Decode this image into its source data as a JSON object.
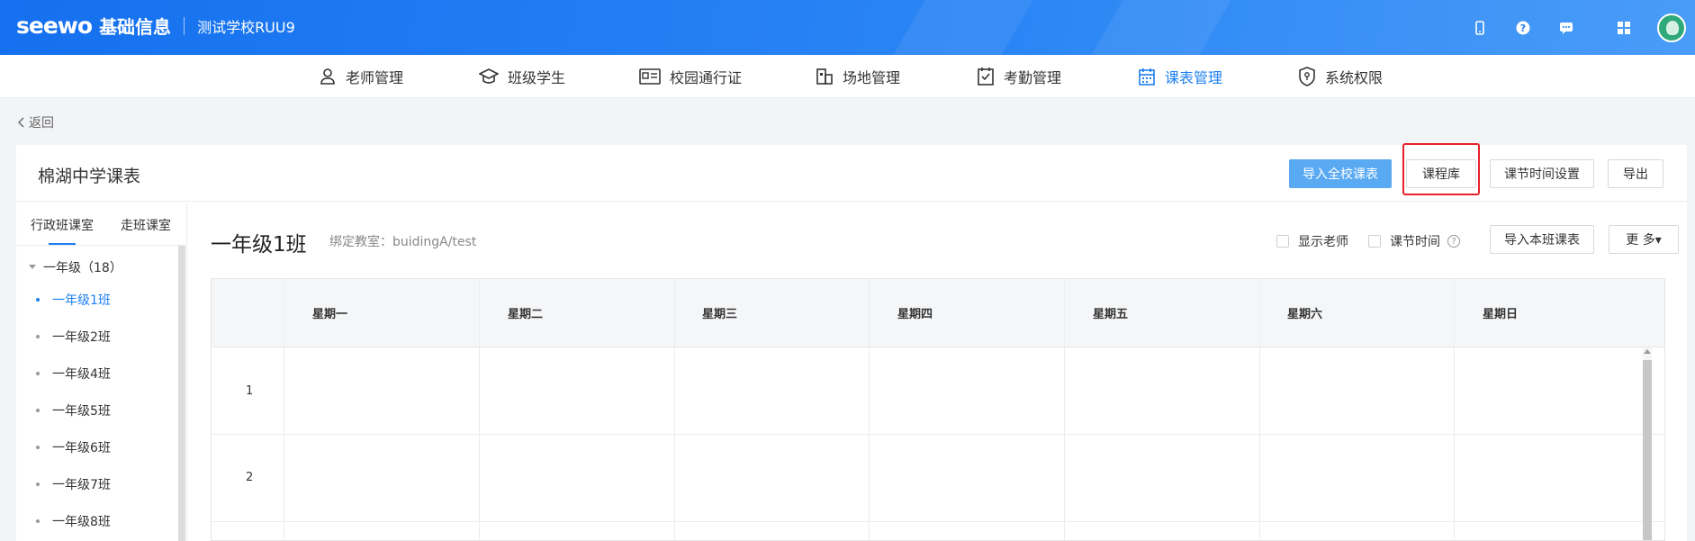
{
  "header": {
    "logo": "seewo",
    "product": "基础信息",
    "school": "测试学校RUU9"
  },
  "nav": {
    "items": [
      {
        "label": "老师管理",
        "icon": "person-icon"
      },
      {
        "label": "班级学生",
        "icon": "graduation-cap-icon"
      },
      {
        "label": "校园通行证",
        "icon": "id-card-icon"
      },
      {
        "label": "场地管理",
        "icon": "building-icon"
      },
      {
        "label": "考勤管理",
        "icon": "clipboard-check-icon"
      },
      {
        "label": "课表管理",
        "icon": "calendar-icon",
        "active": true
      },
      {
        "label": "系统权限",
        "icon": "shield-icon"
      }
    ]
  },
  "back_label": "返回",
  "panel": {
    "title": "棉湖中学课表",
    "buttons": {
      "import_all": "导入全校课表",
      "course_library": "课程库",
      "period_time": "课节时间设置",
      "export": "导出"
    }
  },
  "sidebar": {
    "tabs": [
      "行政班课室",
      "走班课室"
    ],
    "group_label": "一年级（18）",
    "items": [
      "一年级1班",
      "一年级2班",
      "一年级4班",
      "一年级5班",
      "一年级6班",
      "一年级7班",
      "一年级8班"
    ],
    "active_index": 0
  },
  "content": {
    "class_name": "一年级1班",
    "classroom_label": "绑定教室：buidingA/test",
    "show_teacher": "显示老师",
    "period_time": "课节时间",
    "import_class": "导入本班课表",
    "more": "更 多▾"
  },
  "timetable": {
    "days": [
      "星期一",
      "星期二",
      "星期三",
      "星期四",
      "星期五",
      "星期六",
      "星期日"
    ],
    "periods": [
      "1",
      "2"
    ]
  },
  "colors": {
    "brand_blue": "#1d7ff0",
    "primary_button": "#5aaaf3",
    "highlight_red": "#e8212a"
  }
}
